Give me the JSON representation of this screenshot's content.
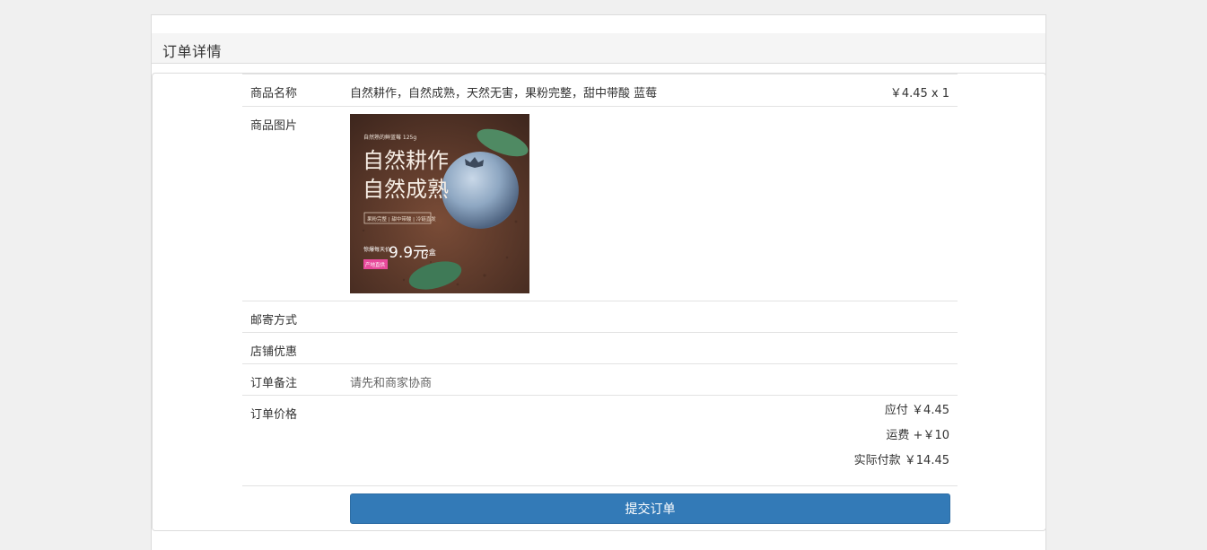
{
  "panel": {
    "title": "订单详情"
  },
  "order": {
    "rows": {
      "name": {
        "label": "商品名称",
        "value": "自然耕作，自然成熟，天然无害，果粉完整，甜中带酸 蓝莓",
        "price_qty": "￥4.45 x 1"
      },
      "image": {
        "label": "商品图片",
        "banner": {
          "top_text": "自然熟的鲜蓝莓 125g",
          "headline_1": "自然耕作",
          "headline_2": "自然成熟",
          "tagline": "果粉完整 | 甜中带酸 | 冷链直发",
          "promo_label": "惊爆每天价:",
          "promo_price": "9.9元",
          "promo_unit": "/2盒",
          "badge": "产地直供"
        }
      },
      "shipping": {
        "label": "邮寄方式",
        "value": ""
      },
      "discount": {
        "label": "店铺优惠",
        "value": ""
      },
      "note": {
        "label": "订单备注",
        "value": "请先和商家协商"
      },
      "price": {
        "label": "订单价格",
        "payable": "应付 ￥4.45",
        "shipping_fee": "运费 +￥10",
        "actual": "实际付款 ￥14.45"
      }
    },
    "submit_label": "提交订单"
  },
  "colors": {
    "primary": "#337ab7",
    "page_bg": "#f0f0f0",
    "heading_bg": "#f5f5f5",
    "border": "#dcdcdc"
  }
}
